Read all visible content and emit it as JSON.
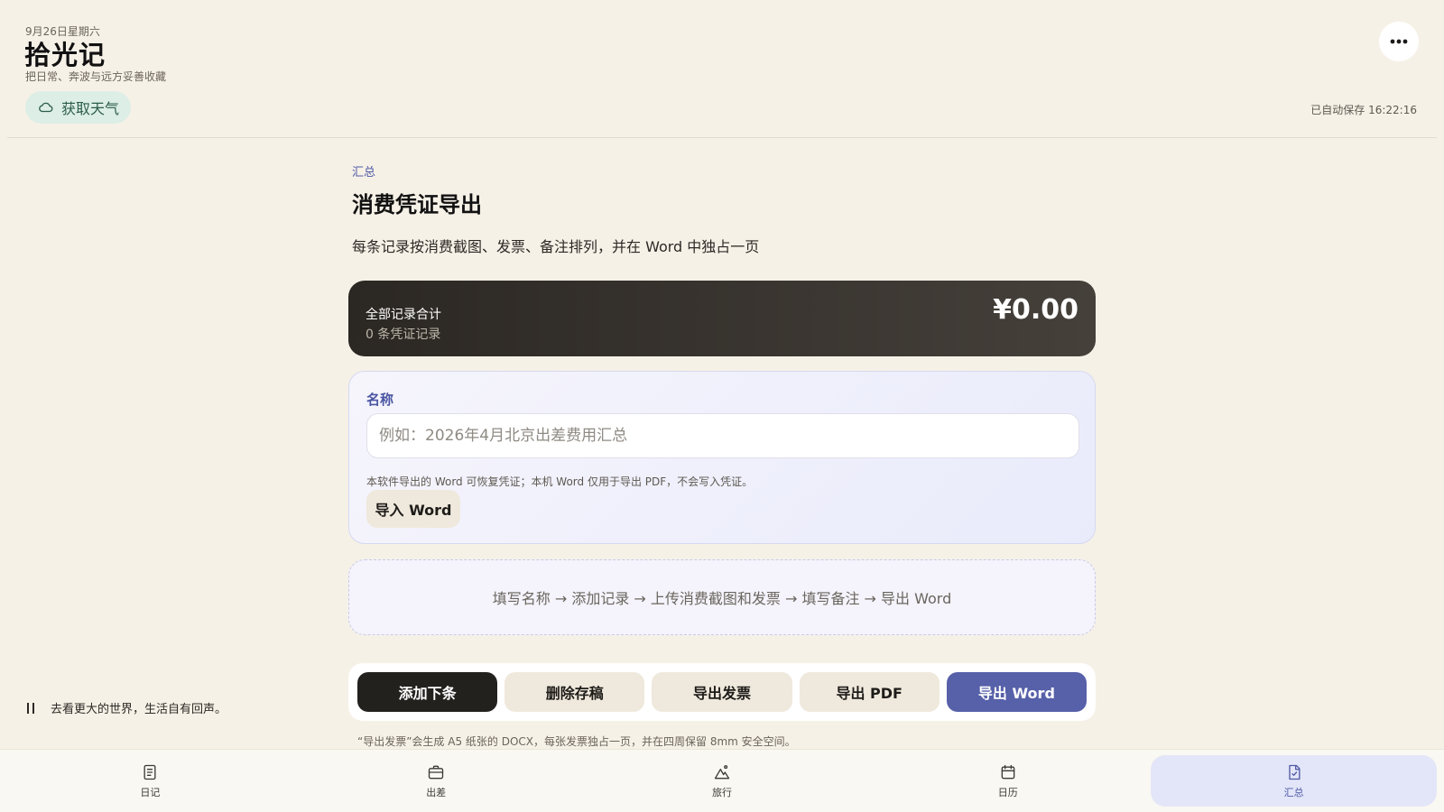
{
  "header": {
    "date": "9月26日星期六",
    "title": "拾光记",
    "subtitle": "把日常、奔波与远方妥善收藏",
    "weather_button": "获取天气",
    "autosave": "已自动保存 16:22:16"
  },
  "main": {
    "section_tag": "汇总",
    "title": "消费凭证导出",
    "description": "每条记录按消费截图、发票、备注排列，并在 Word 中独占一页"
  },
  "total_card": {
    "label": "全部记录合计",
    "count": "0 条凭证记录",
    "amount": "¥0.00"
  },
  "name_card": {
    "label": "名称",
    "placeholder": "例如：2026年4月北京出差费用汇总",
    "value": "",
    "import_note": "本软件导出的 Word 可恢复凭证；本机 Word 仅用于导出 PDF，不会写入凭证。",
    "import_button": "导入 Word"
  },
  "steps": "填写名称 → 添加记录 → 上传消费截图和发票 → 填写备注 → 导出 Word",
  "actions": {
    "add_next": "添加下条",
    "delete_draft": "删除存稿",
    "export_invoice": "导出发票",
    "export_pdf": "导出 PDF",
    "export_word": "导出 Word"
  },
  "footnote": "“导出发票”会生成 A5 纸张的 DOCX，每张发票独占一页，并在四周保留 8mm 安全空间。",
  "music": {
    "text": "去看更大的世界，生活自有回声。",
    "state_icon": "pause-icon"
  },
  "nav": {
    "items": [
      {
        "label": "日记",
        "icon": "diary-icon"
      },
      {
        "label": "出差",
        "icon": "briefcase-icon"
      },
      {
        "label": "旅行",
        "icon": "mountain-icon"
      },
      {
        "label": "日历",
        "icon": "calendar-icon"
      },
      {
        "label": "汇总",
        "icon": "summary-doc-icon",
        "active": true
      }
    ]
  },
  "colors": {
    "background": "#f6f1e7",
    "accent": "#5761a9",
    "dark": "#23211e"
  }
}
